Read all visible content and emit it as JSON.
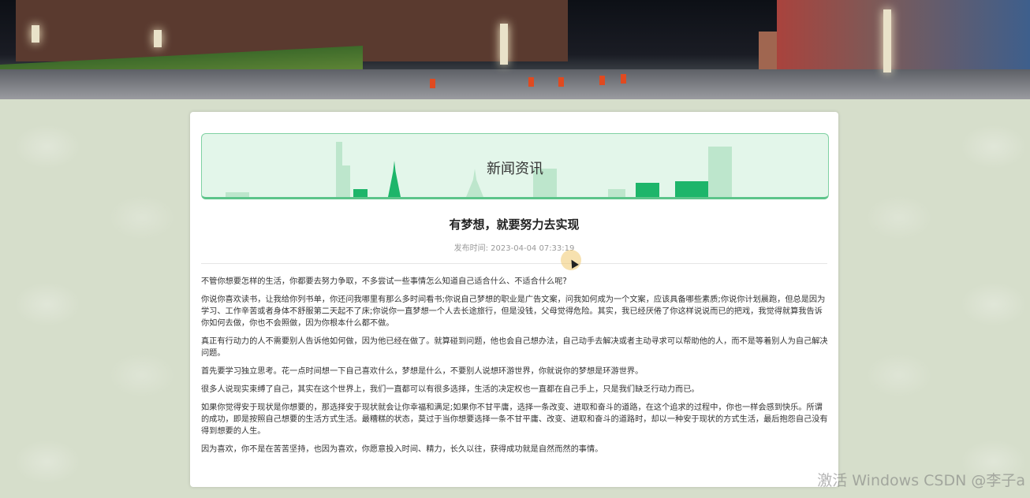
{
  "header": {
    "banner_alt": "campus night view"
  },
  "section": {
    "title": "新闻资讯"
  },
  "article": {
    "title": "有梦想，就要努力去实现",
    "publish_label": "发布时间:",
    "publish_time": "2023-04-04 07:33:19",
    "paragraphs": [
      "不管你想要怎样的生活，你都要去努力争取，不多尝试一些事情怎么知道自己适合什么、不适合什么呢?",
      "你说你喜欢读书，让我给你列书单，你还问我哪里有那么多时间看书;你说自己梦想的职业是广告文案，问我如何成为一个文案，应该具备哪些素质;你说你计划晨跑，但总是因为学习、工作辛苦或者身体不舒服第二天起不了床;你说你一直梦想一个人去长途旅行，但是没钱，父母觉得危险。其实，我已经厌倦了你这样说说而已的把戏，我觉得就算我告诉你如何去做，你也不会照做，因为你根本什么都不做。",
      "真正有行动力的人不需要别人告诉他如何做，因为他已经在做了。就算碰到问题，他也会自己想办法，自己动手去解决或者主动寻求可以帮助他的人，而不是等着别人为自己解决问题。",
      "首先要学习独立思考。花一点时间想一下自己喜欢什么，梦想是什么，不要别人说想环游世界，你就说你的梦想是环游世界。",
      "很多人说现实束缚了自己，其实在这个世界上，我们一直都可以有很多选择，生活的决定权也一直都在自己手上，只是我们缺乏行动力而已。",
      "如果你觉得安于现状是你想要的，那选择安于现状就会让你幸福和满足;如果你不甘平庸，选择一条改变、进取和奋斗的道路，在这个追求的过程中，你也一样会感到快乐。所谓的成功，即是按照自己想要的生活方式生活。最糟糕的状态，莫过于当你想要选择一条不甘平庸、改变、进取和奋斗的道路时，却以一种安于现状的方式生活，最后抱怨自己没有得到想要的人生。",
      "因为喜欢，你不是在苦苦坚持，也因为喜欢，你愿意投入时间、精力，长久以往，获得成功就是自然而然的事情。"
    ]
  },
  "overlay": {
    "watermark": "激活 Windows  CSDN @李子a"
  },
  "colors": {
    "accent_green": "#1db56a",
    "hero_bg": "#e3f6ea",
    "page_bg": "#d8dfcd"
  }
}
